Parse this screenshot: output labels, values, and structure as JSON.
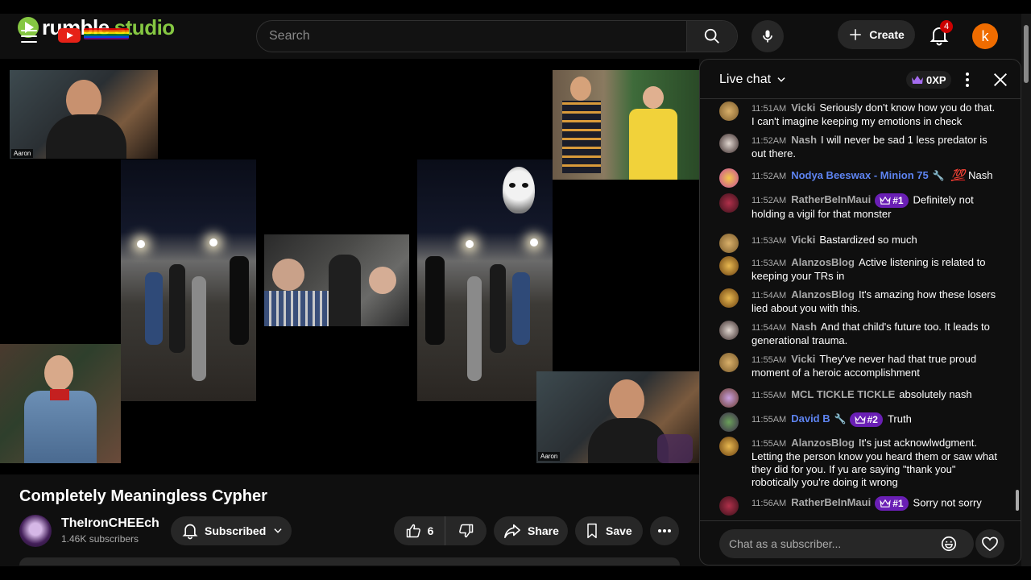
{
  "brand": {
    "name_a": "rumble",
    "name_b": "studio"
  },
  "search": {
    "placeholder": "Search"
  },
  "header": {
    "create_label": "Create",
    "notification_count": "4",
    "avatar_initial": "k"
  },
  "video_overlay": {
    "label_top": "Aaron",
    "label_bottom": "Aaron"
  },
  "video": {
    "title": "Completely Meaningless Cypher",
    "channel": "TheIronCHEEch",
    "subscribers": "1.46K subscribers",
    "subscribe_label": "Subscribed",
    "like_count": "6",
    "share_label": "Share",
    "save_label": "Save"
  },
  "chat": {
    "title": "Live chat",
    "xp": "0XP",
    "input_placeholder": "Chat as a subscriber...",
    "messages": [
      {
        "time": "11:51AM",
        "author": "Vicki",
        "text": "Seriously don't know how you do that. I can't imagine keeping my emotions in check"
      },
      {
        "time": "11:52AM",
        "author": "Nash",
        "text": "I will never be sad 1 less predator is out there."
      },
      {
        "time": "11:52AM",
        "author": "Nodya Beeswax - Minion 75",
        "emoji": "💯",
        "text": "Nash"
      },
      {
        "time": "11:52AM",
        "author": "RatherBeInMaui",
        "badge": "#1",
        "text": "Definitely not holding a vigil for that monster"
      },
      {
        "time": "11:53AM",
        "author": "Vicki",
        "text": "Bastardized so much"
      },
      {
        "time": "11:53AM",
        "author": "AlanzosBlog",
        "text": "Active listening is related to keeping your TRs in"
      },
      {
        "time": "11:54AM",
        "author": "AlanzosBlog",
        "text": "It's amazing how these losers lied about you with this."
      },
      {
        "time": "11:54AM",
        "author": "Nash",
        "text": "And that child's future too. It leads to generational trauma."
      },
      {
        "time": "11:55AM",
        "author": "Vicki",
        "text": "They've never had that true proud moment of a heroic accomplishment"
      },
      {
        "time": "11:55AM",
        "author": "MCL TICKLE TICKLE",
        "text": "absolutely nash"
      },
      {
        "time": "11:55AM",
        "author": "David B",
        "badge": "#2",
        "text": "Truth"
      },
      {
        "time": "11:55AM",
        "author": "AlanzosBlog",
        "text": "It's just acknowlwdgment. Letting the person know you heard them or saw what they did for you. If yu are saying \"thank you\" robotically you're doing it wrong"
      },
      {
        "time": "11:56AM",
        "author": "RatherBeInMaui",
        "badge": "#1",
        "text": "Sorry not sorry"
      }
    ]
  },
  "colors": {
    "accent_green": "#85c742",
    "mod_blue": "#5e84f1",
    "rank_purple": "#6a1fb5",
    "notification_red": "#cc0000",
    "avatar_orange": "#ef6c00"
  }
}
